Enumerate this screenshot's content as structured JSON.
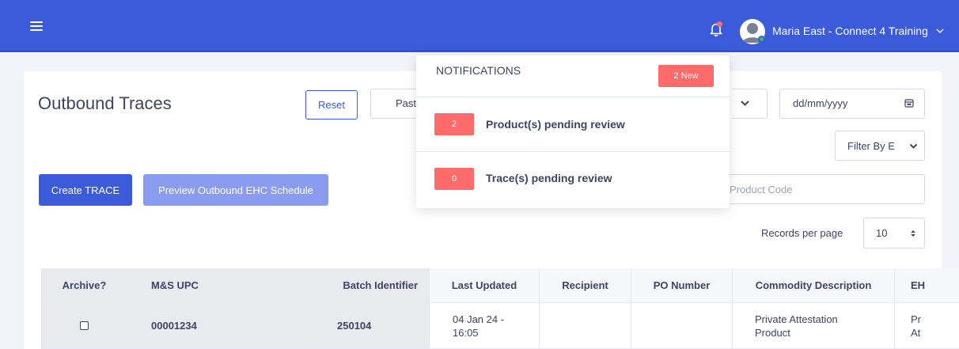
{
  "header": {
    "user_name": "Maria East - Connect 4 Training",
    "icons": {
      "menu": "hamburger-icon",
      "notifications": "bell-icon",
      "avatar": "user-avatar",
      "user_menu": "chevron-down-icon"
    },
    "colors": {
      "bar": "#3b5bdb",
      "alert": "#ff6b6b",
      "online": "#2bc155"
    }
  },
  "page": {
    "title": "Outbound Traces",
    "reset_label": "Reset",
    "period_value": "Past",
    "date_placeholder": "dd/mm/yyyy",
    "filter_value": "Filter By E",
    "create_label": "Create TRACE",
    "preview_label": "Preview Outbound EHC Schedule",
    "product_placeholder": "Product Code",
    "records_label": "Records per page",
    "records_value": "10"
  },
  "notifications": {
    "title": "NOTIFICATIONS",
    "new_badge": "2 New",
    "items": [
      {
        "count": "2",
        "text": "Product(s) pending review"
      },
      {
        "count": "0",
        "text": "Trace(s) pending review"
      }
    ]
  },
  "table": {
    "columns": [
      "Archive?",
      "M&S UPC",
      "Batch Identifier",
      "Last Updated",
      "Recipient",
      "PO Number",
      "Commodity Description",
      "EH"
    ],
    "rows": [
      {
        "archived": false,
        "upc": "00001234",
        "batch": "250104",
        "last_updated": "04 Jan 24 - 16:05",
        "recipient": "",
        "po_number": "",
        "commodity": "Private Attestation Product",
        "eh": "Pr At"
      }
    ]
  }
}
